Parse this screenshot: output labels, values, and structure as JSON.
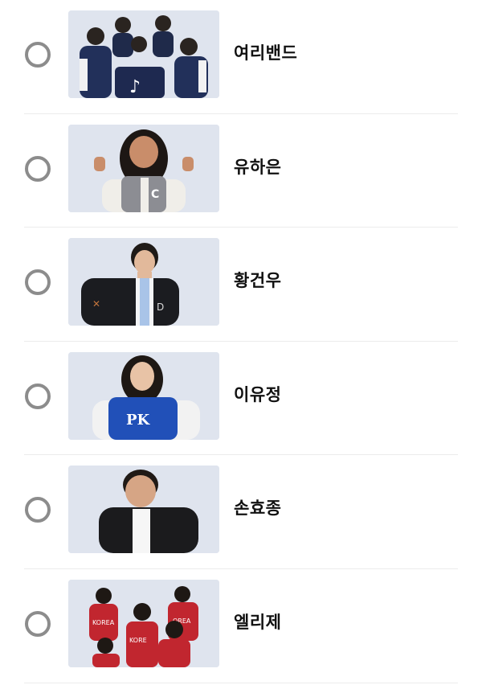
{
  "candidates": [
    {
      "name": "여리밴드",
      "photo": "group-photo-navy-varsity"
    },
    {
      "name": "유하은",
      "photo": "person-photo-grey-varsity"
    },
    {
      "name": "황건우",
      "photo": "person-photo-black-varsity"
    },
    {
      "name": "이유정",
      "photo": "person-photo-blue-varsity"
    },
    {
      "name": "손효종",
      "photo": "person-photo-black-jacket"
    },
    {
      "name": "엘리제",
      "photo": "group-photo-red-jersey"
    }
  ],
  "colors": {
    "radio_border": "#8c8c8c",
    "divider": "#ececec",
    "photo_background": "#dde3ee",
    "text": "#111111"
  }
}
